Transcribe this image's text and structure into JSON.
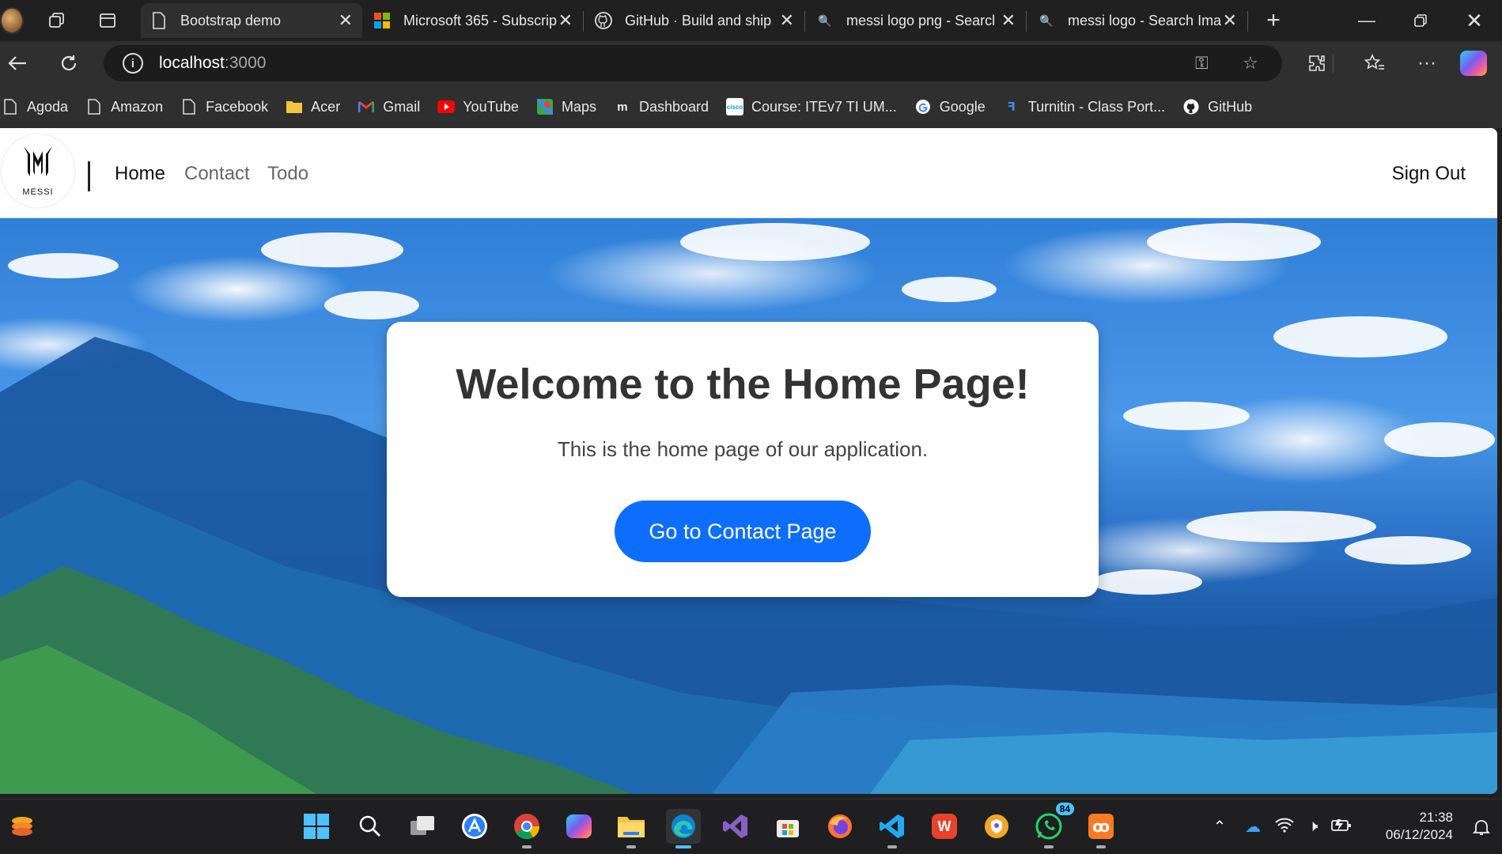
{
  "tabs": [
    {
      "title": "Bootstrap demo",
      "favicon": "page-icon",
      "active": true
    },
    {
      "title": "Microsoft 365 - Subscrip",
      "favicon": "microsoft-icon"
    },
    {
      "title": "GitHub · Build and ship",
      "favicon": "github-icon"
    },
    {
      "title": "messi logo png - Searcl",
      "favicon": "search-icon"
    },
    {
      "title": "messi logo - Search Ima",
      "favicon": "search-icon"
    }
  ],
  "address": {
    "host": "localhost",
    "port": ":3000"
  },
  "bookmarks": [
    {
      "label": "Agoda",
      "icon": "page-icon"
    },
    {
      "label": "Amazon",
      "icon": "page-icon"
    },
    {
      "label": "Facebook",
      "icon": "page-icon"
    },
    {
      "label": "Acer",
      "icon": "folder-icon"
    },
    {
      "label": "Gmail",
      "icon": "gmail-icon"
    },
    {
      "label": "YouTube",
      "icon": "youtube-icon"
    },
    {
      "label": "Maps",
      "icon": "maps-icon"
    },
    {
      "label": "Dashboard",
      "icon": "dashboard-icon"
    },
    {
      "label": "Course: ITEv7 TI UM...",
      "icon": "cisco-icon"
    },
    {
      "label": "Google",
      "icon": "google-icon"
    },
    {
      "label": "Turnitin - Class Port...",
      "icon": "turnitin-icon"
    },
    {
      "label": "GitHub",
      "icon": "github-icon"
    }
  ],
  "site": {
    "logo_text": "MESSI",
    "nav": [
      "Home",
      "Contact",
      "Todo"
    ],
    "sign_out": "Sign Out"
  },
  "card": {
    "heading": "Welcome to the Home Page!",
    "text": "This is the home page of our application.",
    "button": "Go to Contact Page"
  },
  "taskbar": {
    "whatsapp_badge": "84",
    "time": "21:38",
    "date": "06/12/2024"
  },
  "colors": {
    "primary": "#0d6efd",
    "browser_chrome": "#2f2f2f"
  }
}
